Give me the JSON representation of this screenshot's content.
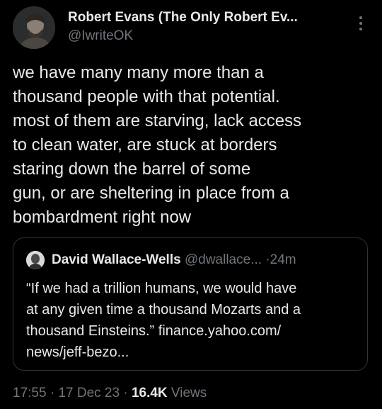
{
  "author": {
    "name": "Robert Evans (The Only Robert Ev...",
    "handle": "@IwriteOK"
  },
  "icons": {
    "more": "more-vertical-icon"
  },
  "tweet": {
    "text": "we have many many more than a\nthousand people with that potential.\nmost of them are starving, lack access\nto clean water, are stuck at borders\nstaring down the barrel of some\ngun, or are sheltering in place from a\nbombardment right now"
  },
  "quote": {
    "name": "David Wallace-Wells",
    "handle": "@dwallace...",
    "separator": "·",
    "time": "24m",
    "text": "“If we had a trillion humans, we would have\nat any given time a thousand Mozarts and a\nthousand Einsteins.” finance.yahoo.com/\nnews/jeff-bezo..."
  },
  "meta": {
    "time": "17:55",
    "sep1": " · ",
    "date": "17 Dec 23",
    "sep2": " · ",
    "views_count": "16.4K",
    "views_label": " Views"
  },
  "colors": {
    "background": "#000000",
    "text": "#e7e9ea",
    "secondary": "#71767b",
    "border": "#2f3336"
  }
}
